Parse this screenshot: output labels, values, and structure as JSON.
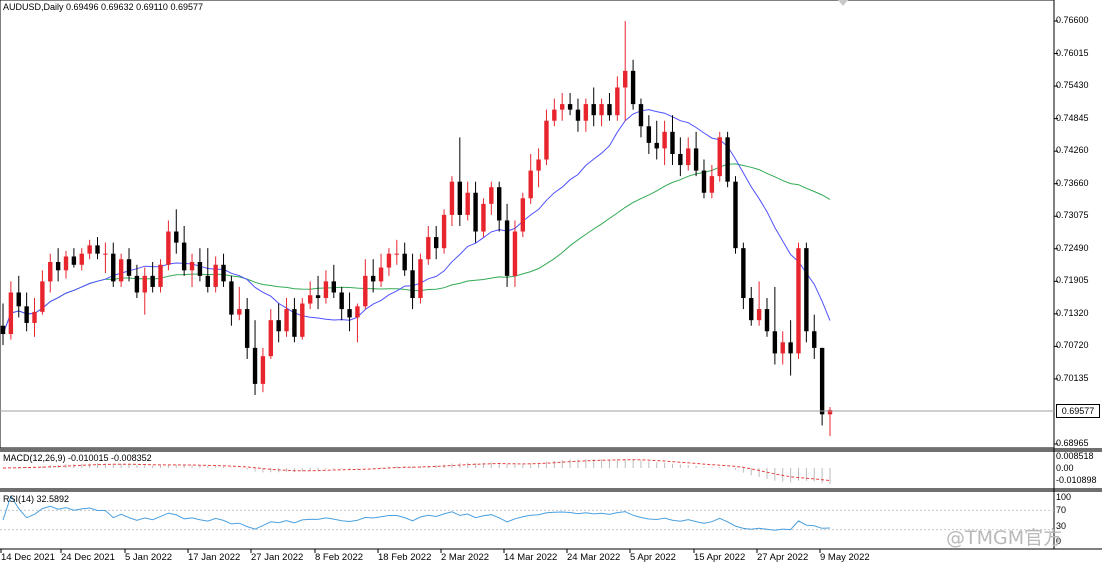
{
  "main_panel": {
    "title": "AUDUSD,Daily  0.69496 0.69632 0.69110 0.69577",
    "current_price_label": "0.69577",
    "price_ticks": [
      "0.76600",
      "0.76015",
      "0.75430",
      "0.74845",
      "0.74260",
      "0.73660",
      "0.73075",
      "0.72490",
      "0.71905",
      "0.71320",
      "0.70720",
      "0.70135",
      "0.69550",
      "0.68965"
    ]
  },
  "macd_panel": {
    "title": "MACD(12,26,9) -0.010015 -0.008352",
    "ticks": [
      "0.008518",
      "0.00",
      "-0.010898"
    ]
  },
  "rsi_panel": {
    "title": "RSI(14) 32.5892",
    "ticks": [
      "100",
      "70",
      "30",
      "0"
    ]
  },
  "time_axis": {
    "labels": [
      "14 Dec 2021",
      "24 Dec 2021",
      "5 Jan 2022",
      "17 Jan 2022",
      "27 Jan 2022",
      "8 Feb 2022",
      "18 Feb 2022",
      "2 Mar 2022",
      "14 Mar 2022",
      "24 Mar 2022",
      "5 Apr 2022",
      "15 Apr 2022",
      "27 Apr 2022",
      "9 May 2022"
    ]
  },
  "watermark": "@TMGM官方",
  "colors": {
    "bull_candle": "#e8242c",
    "bear_candle": "#000000",
    "fast_ma": "#5050ff",
    "slow_ma": "#33aa55",
    "macd_line": "#e84040",
    "macd_hist": "#bbbbbb",
    "rsi_line": "#4aa0e0"
  },
  "chart_data": {
    "type": "candlestick",
    "symbol": "AUDUSD",
    "timeframe": "Daily",
    "y_range": [
      0.688,
      0.768
    ],
    "last_price": 0.69577,
    "ohlc": [
      [
        0.711,
        0.715,
        0.7075,
        0.7095
      ],
      [
        0.7095,
        0.719,
        0.7085,
        0.717
      ],
      [
        0.717,
        0.72,
        0.7125,
        0.7145
      ],
      [
        0.7145,
        0.717,
        0.71,
        0.7115
      ],
      [
        0.7115,
        0.716,
        0.709,
        0.7135
      ],
      [
        0.7135,
        0.721,
        0.713,
        0.719
      ],
      [
        0.719,
        0.724,
        0.717,
        0.7225
      ],
      [
        0.7225,
        0.725,
        0.719,
        0.721
      ],
      [
        0.721,
        0.7245,
        0.7195,
        0.7235
      ],
      [
        0.7235,
        0.725,
        0.7215,
        0.722
      ],
      [
        0.722,
        0.725,
        0.721,
        0.724
      ],
      [
        0.724,
        0.7265,
        0.723,
        0.7255
      ],
      [
        0.7255,
        0.727,
        0.723,
        0.724
      ],
      [
        0.724,
        0.726,
        0.7205,
        0.724
      ],
      [
        0.724,
        0.726,
        0.718,
        0.719
      ],
      [
        0.719,
        0.724,
        0.718,
        0.723
      ],
      [
        0.723,
        0.725,
        0.719,
        0.72
      ],
      [
        0.72,
        0.722,
        0.716,
        0.717
      ],
      [
        0.717,
        0.7215,
        0.713,
        0.72
      ],
      [
        0.72,
        0.7225,
        0.717,
        0.718
      ],
      [
        0.718,
        0.723,
        0.717,
        0.722
      ],
      [
        0.722,
        0.73,
        0.721,
        0.728
      ],
      [
        0.728,
        0.732,
        0.724,
        0.726
      ],
      [
        0.726,
        0.729,
        0.72,
        0.721
      ],
      [
        0.721,
        0.724,
        0.718,
        0.7225
      ],
      [
        0.7225,
        0.725,
        0.719,
        0.72
      ],
      [
        0.72,
        0.725,
        0.717,
        0.718
      ],
      [
        0.718,
        0.7235,
        0.717,
        0.722
      ],
      [
        0.722,
        0.724,
        0.718,
        0.719
      ],
      [
        0.719,
        0.72,
        0.711,
        0.713
      ],
      [
        0.713,
        0.718,
        0.712,
        0.714
      ],
      [
        0.714,
        0.716,
        0.705,
        0.707
      ],
      [
        0.707,
        0.712,
        0.6985,
        0.7005
      ],
      [
        0.7005,
        0.707,
        0.699,
        0.7055
      ],
      [
        0.7055,
        0.714,
        0.705,
        0.712
      ],
      [
        0.712,
        0.715,
        0.708,
        0.71
      ],
      [
        0.71,
        0.716,
        0.709,
        0.714
      ],
      [
        0.714,
        0.716,
        0.708,
        0.709
      ],
      [
        0.709,
        0.716,
        0.7085,
        0.715
      ],
      [
        0.715,
        0.719,
        0.714,
        0.7165
      ],
      [
        0.7165,
        0.72,
        0.714,
        0.716
      ],
      [
        0.716,
        0.721,
        0.715,
        0.719
      ],
      [
        0.719,
        0.722,
        0.716,
        0.717
      ],
      [
        0.717,
        0.718,
        0.712,
        0.714
      ],
      [
        0.714,
        0.717,
        0.71,
        0.7125
      ],
      [
        0.7125,
        0.715,
        0.708,
        0.7145
      ],
      [
        0.7145,
        0.723,
        0.714,
        0.72
      ],
      [
        0.72,
        0.723,
        0.717,
        0.719
      ],
      [
        0.719,
        0.724,
        0.718,
        0.7215
      ],
      [
        0.7215,
        0.725,
        0.72,
        0.724
      ],
      [
        0.724,
        0.7265,
        0.722,
        0.724
      ],
      [
        0.724,
        0.726,
        0.72,
        0.721
      ],
      [
        0.721,
        0.724,
        0.714,
        0.716
      ],
      [
        0.716,
        0.724,
        0.715,
        0.723
      ],
      [
        0.723,
        0.729,
        0.722,
        0.727
      ],
      [
        0.727,
        0.729,
        0.723,
        0.725
      ],
      [
        0.725,
        0.732,
        0.724,
        0.731
      ],
      [
        0.731,
        0.738,
        0.729,
        0.737
      ],
      [
        0.737,
        0.745,
        0.729,
        0.731
      ],
      [
        0.731,
        0.737,
        0.73,
        0.735
      ],
      [
        0.735,
        0.737,
        0.726,
        0.728
      ],
      [
        0.728,
        0.734,
        0.727,
        0.733
      ],
      [
        0.733,
        0.737,
        0.731,
        0.736
      ],
      [
        0.736,
        0.737,
        0.728,
        0.73
      ],
      [
        0.73,
        0.733,
        0.718,
        0.72
      ],
      [
        0.72,
        0.73,
        0.718,
        0.728
      ],
      [
        0.728,
        0.735,
        0.727,
        0.734
      ],
      [
        0.734,
        0.742,
        0.733,
        0.739
      ],
      [
        0.739,
        0.743,
        0.736,
        0.741
      ],
      [
        0.741,
        0.75,
        0.74,
        0.748
      ],
      [
        0.748,
        0.752,
        0.747,
        0.75
      ],
      [
        0.75,
        0.753,
        0.748,
        0.751
      ],
      [
        0.751,
        0.753,
        0.749,
        0.75
      ],
      [
        0.75,
        0.752,
        0.746,
        0.748
      ],
      [
        0.748,
        0.752,
        0.746,
        0.751
      ],
      [
        0.751,
        0.754,
        0.747,
        0.749
      ],
      [
        0.749,
        0.752,
        0.747,
        0.751
      ],
      [
        0.751,
        0.753,
        0.748,
        0.749
      ],
      [
        0.749,
        0.756,
        0.748,
        0.754
      ],
      [
        0.754,
        0.766,
        0.748,
        0.757
      ],
      [
        0.757,
        0.759,
        0.75,
        0.751
      ],
      [
        0.751,
        0.752,
        0.745,
        0.747
      ],
      [
        0.747,
        0.749,
        0.742,
        0.744
      ],
      [
        0.744,
        0.748,
        0.741,
        0.743
      ],
      [
        0.743,
        0.748,
        0.74,
        0.746
      ],
      [
        0.746,
        0.749,
        0.74,
        0.742
      ],
      [
        0.742,
        0.745,
        0.738,
        0.74
      ],
      [
        0.74,
        0.745,
        0.739,
        0.743
      ],
      [
        0.743,
        0.746,
        0.738,
        0.739
      ],
      [
        0.739,
        0.741,
        0.734,
        0.735
      ],
      [
        0.735,
        0.74,
        0.734,
        0.738
      ],
      [
        0.738,
        0.746,
        0.737,
        0.745
      ],
      [
        0.745,
        0.746,
        0.736,
        0.737
      ],
      [
        0.737,
        0.738,
        0.724,
        0.725
      ],
      [
        0.725,
        0.726,
        0.714,
        0.716
      ],
      [
        0.716,
        0.718,
        0.711,
        0.712
      ],
      [
        0.712,
        0.719,
        0.711,
        0.714
      ],
      [
        0.714,
        0.716,
        0.709,
        0.71
      ],
      [
        0.71,
        0.718,
        0.704,
        0.706
      ],
      [
        0.706,
        0.71,
        0.704,
        0.708
      ],
      [
        0.708,
        0.712,
        0.702,
        0.706
      ],
      [
        0.706,
        0.726,
        0.705,
        0.725
      ],
      [
        0.725,
        0.726,
        0.708,
        0.71
      ],
      [
        0.71,
        0.713,
        0.705,
        0.707
      ],
      [
        0.707,
        0.707,
        0.693,
        0.695
      ],
      [
        0.695,
        0.6963,
        0.6911,
        0.6958
      ]
    ],
    "indicators": [
      "MA fast",
      "MA slow",
      "MACD(12,26,9)",
      "RSI(14)"
    ]
  }
}
